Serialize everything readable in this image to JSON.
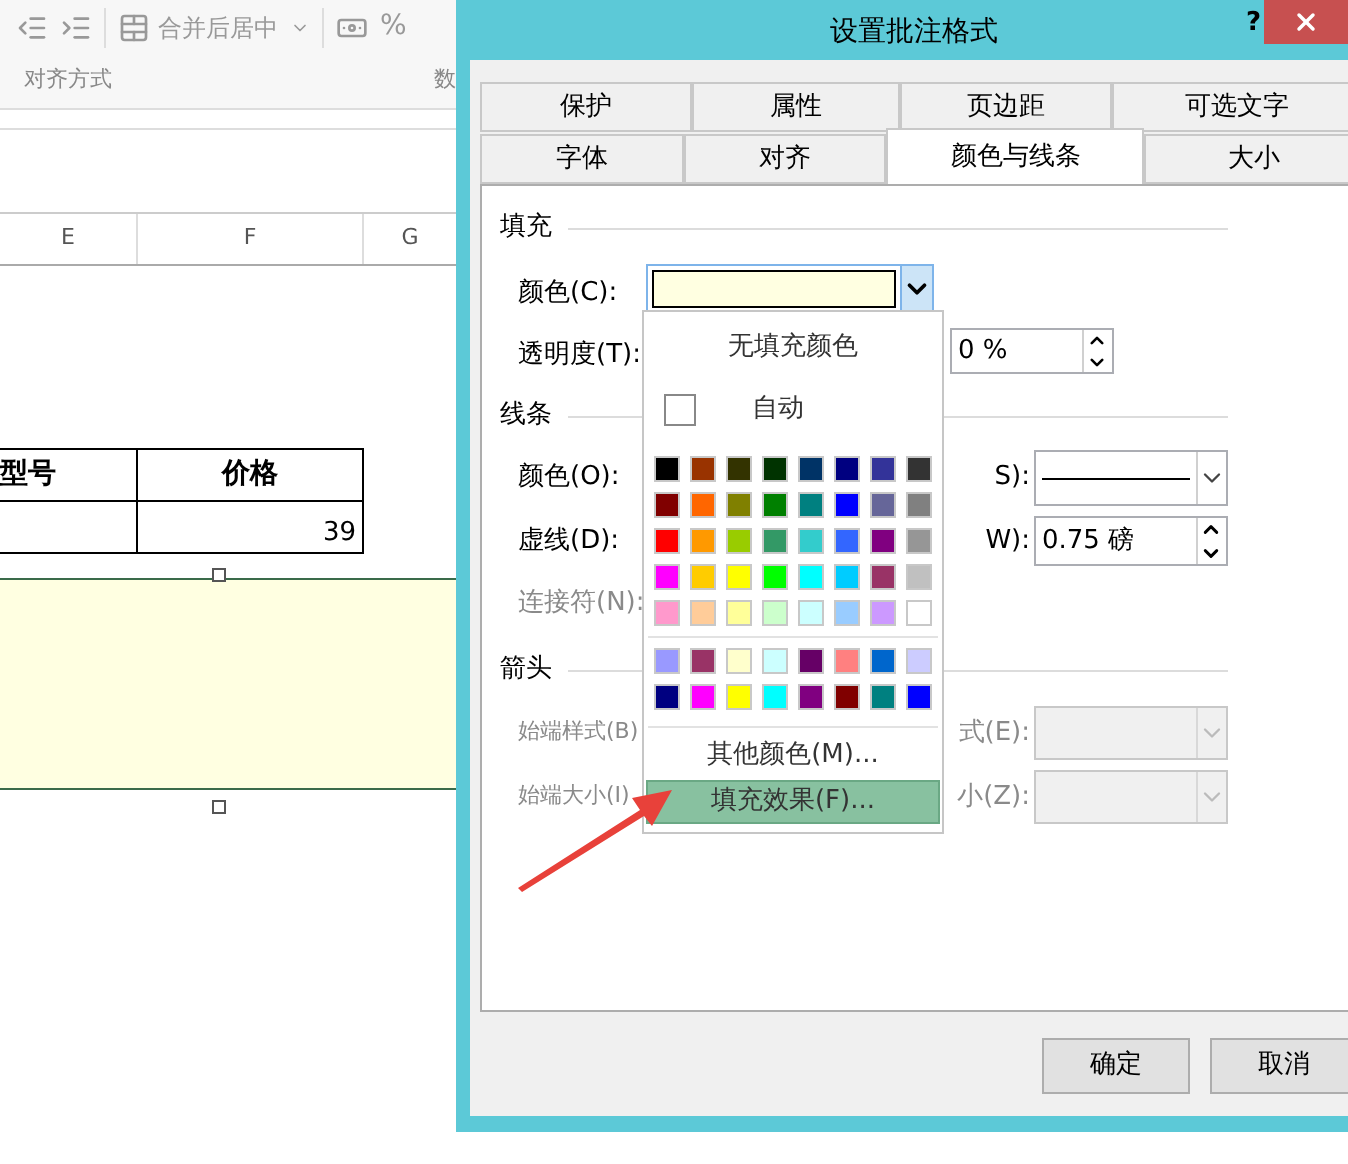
{
  "spreadsheet": {
    "ribbon": {
      "merge_button": "合并后居中",
      "percent_button": "%",
      "group_label": "对齐方式",
      "next_group_label": "数"
    },
    "columns": [
      "E",
      "F",
      "G"
    ],
    "table": {
      "headers": [
        "型号",
        "价格"
      ],
      "rows": [
        [
          "",
          "39"
        ]
      ]
    }
  },
  "dialog": {
    "title": "设置批注格式",
    "help": "?",
    "tabs": [
      [
        {
          "label": "保护",
          "selected": false
        },
        {
          "label": "属性",
          "selected": false
        },
        {
          "label": "页边距",
          "selected": false
        },
        {
          "label": "可选文字",
          "selected": false
        }
      ],
      [
        {
          "label": "字体",
          "selected": false
        },
        {
          "label": "对齐",
          "selected": false
        },
        {
          "label": "颜色与线条",
          "selected": true
        },
        {
          "label": "大小",
          "selected": false
        }
      ]
    ],
    "fill": {
      "heading": "填充",
      "color_label": "颜色(C):",
      "transparency_label": "透明度(T):",
      "transparency_value": "0 %"
    },
    "line": {
      "heading": "线条",
      "color_label": "颜色(O):",
      "style_label": "S):",
      "dash_label": "虚线(D):",
      "weight_label": "W):",
      "weight_value": "0.75 磅",
      "connector_label": "连接符(N):",
      "connector_disabled": true
    },
    "arrows": {
      "heading": "箭头",
      "disabled": true,
      "begin_style_label": "始端样式(B)",
      "end_style_label": "式(E):",
      "begin_size_label": "始端大小(I)",
      "end_size_label": "小(Z):"
    },
    "buttons": [
      "确定",
      "取消"
    ]
  },
  "color_menu": {
    "no_fill": "无填充颜色",
    "automatic": "自动",
    "standard_colors": [
      {
        "color": "#000000"
      },
      {
        "color": "#993300"
      },
      {
        "color": "#333300"
      },
      {
        "color": "#003300"
      },
      {
        "color": "#003366"
      },
      {
        "color": "#000080"
      },
      {
        "color": "#333399"
      },
      {
        "color": "#333333"
      },
      {
        "color": "#800000"
      },
      {
        "color": "#ff6600"
      },
      {
        "color": "#808000"
      },
      {
        "color": "#008000"
      },
      {
        "color": "#008080"
      },
      {
        "color": "#0000ff"
      },
      {
        "color": "#666699"
      },
      {
        "color": "#808080"
      },
      {
        "color": "#ff0000"
      },
      {
        "color": "#ff9900"
      },
      {
        "color": "#99cc00"
      },
      {
        "color": "#339966"
      },
      {
        "color": "#33cccc"
      },
      {
        "color": "#3366ff"
      },
      {
        "color": "#800080"
      },
      {
        "color": "#969696"
      },
      {
        "color": "#ff00ff"
      },
      {
        "color": "#ffcc00"
      },
      {
        "color": "#ffff00"
      },
      {
        "color": "#00ff00"
      },
      {
        "color": "#00ffff"
      },
      {
        "color": "#00ccff"
      },
      {
        "color": "#993366"
      },
      {
        "color": "#c0c0c0"
      },
      {
        "color": "#ff99cc"
      },
      {
        "color": "#ffcc99"
      },
      {
        "color": "#ffff99"
      },
      {
        "color": "#ccffcc"
      },
      {
        "color": "#ccffff"
      },
      {
        "color": "#99ccff"
      },
      {
        "color": "#cc99ff"
      },
      {
        "color": "#ffffff"
      }
    ],
    "recent_colors": [
      {
        "color": "#9999ff"
      },
      {
        "color": "#993366"
      },
      {
        "color": "#ffffcc"
      },
      {
        "color": "#ccffff"
      },
      {
        "color": "#660066"
      },
      {
        "color": "#ff8080"
      },
      {
        "color": "#0066cc"
      },
      {
        "color": "#ccccff"
      },
      {
        "color": "#000080"
      },
      {
        "color": "#ff00ff"
      },
      {
        "color": "#ffff00"
      },
      {
        "color": "#00ffff"
      },
      {
        "color": "#800080"
      },
      {
        "color": "#800000"
      },
      {
        "color": "#008080"
      },
      {
        "color": "#0000ff"
      }
    ],
    "more_colors": "其他颜色(M)...",
    "fill_effects": {
      "label": "填充效果(F)...",
      "highlighted": true
    }
  }
}
